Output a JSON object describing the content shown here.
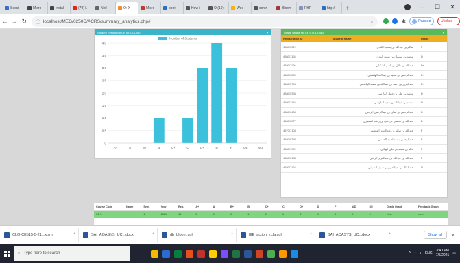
{
  "browser": {
    "tabs": [
      {
        "label": "Sessi",
        "color": "#3b6ccf"
      },
      {
        "label": "Micro",
        "color": "#444"
      },
      {
        "label": "Instal",
        "color": "#444"
      },
      {
        "label": "(79) L",
        "color": "#e62117"
      },
      {
        "label": "Neil",
        "color": "#666"
      },
      {
        "label": "O: X",
        "color": "#f28c28",
        "active": true
      },
      {
        "label": "Micro",
        "color": "#c0392b"
      },
      {
        "label": "boot:",
        "color": "#2c6fbb"
      },
      {
        "label": "How t",
        "color": "#555"
      },
      {
        "label": "O (19):",
        "color": "#555"
      },
      {
        "label": "Wee",
        "color": "#f4b400"
      },
      {
        "label": "contr",
        "color": "#555"
      },
      {
        "label": "Bloom",
        "color": "#a33"
      },
      {
        "label": "PHP I",
        "color": "#8892bf"
      },
      {
        "label": "http:/",
        "color": "#2c6fbb"
      }
    ],
    "new_tab": "+",
    "url": "localhost/MEG/0250C/ACRS/summary_analytics.php#",
    "profile_label": "Paused",
    "update_label": "Update"
  },
  "chart_panel": {
    "title": "Student Results for CE 5 (5-1-LAB)"
  },
  "chart_data": {
    "type": "bar",
    "categories": [
      "A+",
      "A",
      "B+",
      "B",
      "C+",
      "C",
      "D+",
      "D",
      "F",
      "DE",
      "WD"
    ],
    "values": [
      0,
      0,
      0,
      1,
      0,
      1,
      3,
      4,
      3,
      0,
      0
    ],
    "series": [
      {
        "name": "Number of Students",
        "values": [
          0,
          0,
          0,
          1,
          0,
          1,
          3,
          4,
          3,
          0,
          0
        ]
      }
    ],
    "yticks": [
      "0",
      "0.5",
      "1.0",
      "1.5",
      "2.0",
      "2.5",
      "3.0",
      "3.5",
      "4.0"
    ],
    "ylim": [
      0,
      4
    ],
    "bar_color": "#3cc1dc",
    "grid": true,
    "legend": "top"
  },
  "students_panel": {
    "title": "Grade details for CE 5 (5-1-LAB)",
    "columns": [
      "Registration ID",
      "Student Name",
      "Grade"
    ],
    "rows": [
      [
        "4380/0312",
        "سالم بن عبدالله بن سعيد الكندي",
        "F"
      ],
      [
        "4380/1108",
        "محمد بن سليمان بن سعيد البادي",
        "D"
      ],
      [
        "4380/1106",
        "عبدالله بن هلال بن ناصر الشكيلي",
        "D+"
      ],
      [
        "4380/0832",
        "عبدالرحمن بن سعيد بن عبدالله الهاشمي",
        "D+"
      ],
      [
        "4380/0703",
        "عبدالعزيز بن احمد بن عبدالله بن سعيد الهاشمي",
        "D+"
      ],
      [
        "4380/0394",
        "محمد بن علي بن خليل الفارسي",
        "D"
      ],
      [
        "4380/1168",
        "محمد بن عبدالله بن سعيد البلوشي",
        "D"
      ],
      [
        "4380/0408",
        "عبدالرحمن بن صالح بن عبدالرحمن الرحبي",
        "D"
      ],
      [
        "4380/0377",
        "عبدالله بن محسن بن علي بن راشد المعمري",
        "D"
      ],
      [
        "4370/7108",
        "عبدالله بن سالم بن عبدالعزيز الهاشمي",
        "F"
      ],
      [
        "4380/0798",
        "عبدالرحمن محمد احمد الحسني",
        "F"
      ],
      [
        "4380/1992",
        "خالد بن سعيد بن علي الهنائي",
        "F"
      ],
      [
        "4380/0138",
        "عبدالله بن عبدالله بن عبدالعزيز الرحبي",
        "F"
      ],
      [
        "4380/1108",
        "عبدالملك بن عبدالعزيز بن سيف السيابي",
        "D"
      ]
    ]
  },
  "course_table": {
    "columns": [
      "Course Code",
      "Name",
      "Sem.",
      "Year",
      "Reg.",
      "A+",
      "A",
      "B+",
      "B",
      "C+",
      "C",
      "D+",
      "D",
      "F",
      "WD",
      "DE",
      "Grade Graph",
      "Feedback Graph"
    ],
    "row": [
      "CE 5",
      "",
      "1",
      "2021",
      "14",
      "0",
      "0",
      "0",
      "1",
      "0",
      "1",
      "3",
      "4",
      "3",
      "0",
      "0",
      "view",
      "view"
    ]
  },
  "downloads": {
    "items": [
      "CLO-CE515-5-21...xlsm",
      "SAI_AQASYS_UC...docx",
      "db_bloom.sql",
      "IIIE_action_ircla.sql",
      "SAI_AQASYS_UC...docx"
    ],
    "show_all": "Show all",
    "close": "×"
  },
  "taskbar": {
    "search_placeholder": "Type here to search",
    "time": "3:40 PM",
    "date": "7/5/2021",
    "lang": "ENG",
    "icon_colors": [
      "#f5b800",
      "#2b6cd4",
      "#0a7c3e",
      "#e94e1b",
      "#c4302b",
      "#ffcc00",
      "#7c4dff",
      "#217346",
      "#2b579a",
      "#d04423",
      "#4caf50",
      "#ff9800",
      "#1e88e5"
    ]
  }
}
